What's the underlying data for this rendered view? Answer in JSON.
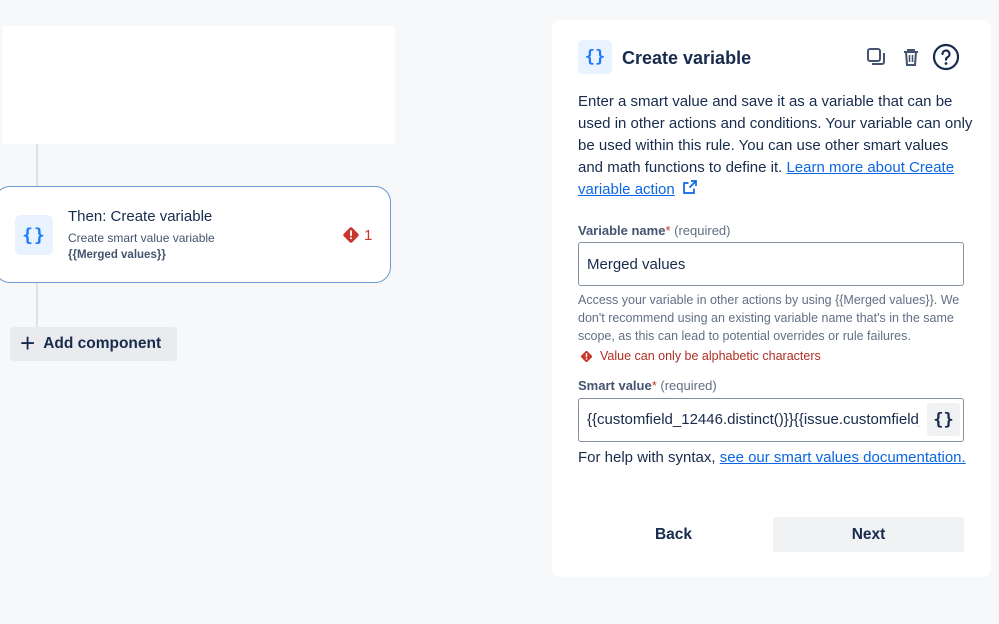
{
  "canvas": {
    "rule_card": {
      "icon": "{}",
      "title": "Then: Create variable",
      "subtitle": "Create smart value variable",
      "variable": "{{Merged values}}",
      "error_count": "1"
    },
    "add_component_label": "Add component"
  },
  "panel": {
    "icon": "{}",
    "title": "Create variable",
    "description_text": "Enter a smart value and save it as a variable that can be used in other actions and conditions. Your variable can only be used within this rule. You can use other smart values and math functions to define it. ",
    "description_link": "Learn more about Create variable action",
    "variable_name": {
      "label": "Variable name",
      "required_marker": "*",
      "required_text": "(required)",
      "value": "Merged values",
      "hint": "Access your variable in other actions by using {{Merged values}}. We don't recommend using an existing variable name that's in the same scope, as this can lead to potential overrides or rule failures.",
      "error": "Value can only be alphabetic characters"
    },
    "smart_value": {
      "label": "Smart value",
      "required_marker": "*",
      "required_text": "(required)",
      "value": "{{customfield_12446.distinct()}}{{issue.customfield_",
      "insert_icon": "{}"
    },
    "help_text": "For help with syntax, ",
    "help_link": "see our smart values documentation.",
    "back_label": "Back",
    "next_label": "Next"
  },
  "colors": {
    "accent": "#1d7afc",
    "link": "#0c66e4",
    "error": "#c9372c",
    "card_border": "#6c9bd2"
  }
}
